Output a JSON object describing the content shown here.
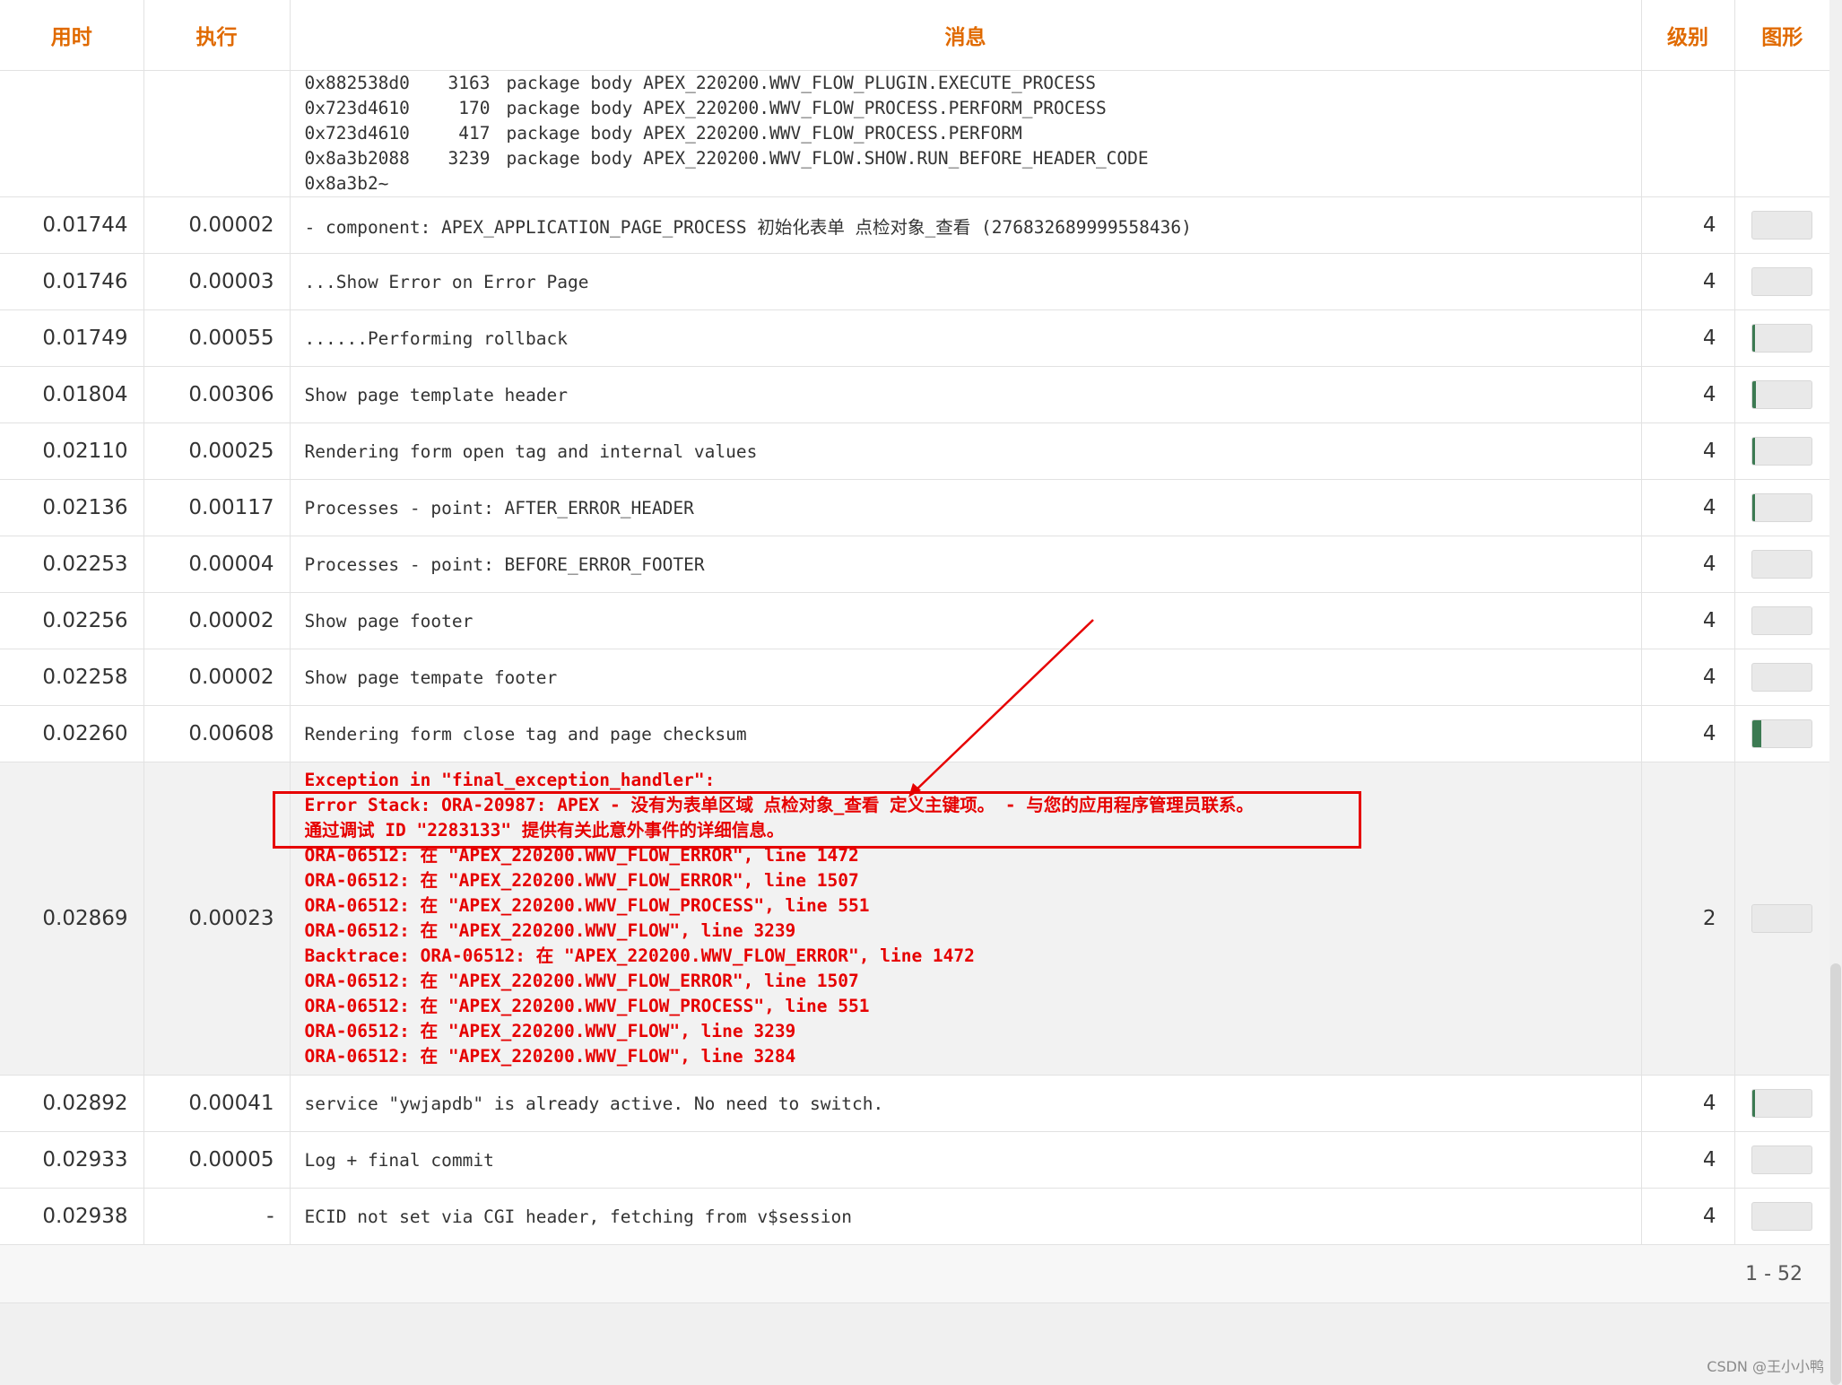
{
  "columns": {
    "elapsed": "用时",
    "exec": "执行",
    "message": "消息",
    "level": "级别",
    "graph": "图形"
  },
  "stack_lines": [
    {
      "addr": "0x882538d0",
      "line": "3163",
      "text": "package body APEX_220200.WWV_FLOW_PLUGIN.EXECUTE_PROCESS"
    },
    {
      "addr": "0x723d4610",
      "line": "170",
      "text": "package body APEX_220200.WWV_FLOW_PROCESS.PERFORM_PROCESS"
    },
    {
      "addr": "0x723d4610",
      "line": "417",
      "text": "package body APEX_220200.WWV_FLOW_PROCESS.PERFORM"
    },
    {
      "addr": "0x8a3b2088",
      "line": "3239",
      "text": "package body APEX_220200.WWV_FLOW.SHOW.RUN_BEFORE_HEADER_CODE"
    },
    {
      "addr": "0x8a3b2~",
      "line": "",
      "text": ""
    }
  ],
  "rows_a": [
    {
      "elapsed": "0.01744",
      "exec": "0.00002",
      "message": "- component: APEX_APPLICATION_PAGE_PROCESS 初始化表单 点检对象_查看 (276832689999558436)",
      "level": "4",
      "fill": 0.0
    },
    {
      "elapsed": "0.01746",
      "exec": "0.00003",
      "message": "...Show Error on Error Page",
      "level": "4",
      "fill": 0.0
    },
    {
      "elapsed": "0.01749",
      "exec": "0.00055",
      "message": "......Performing rollback",
      "level": "4",
      "fill": 0.02
    },
    {
      "elapsed": "0.01804",
      "exec": "0.00306",
      "message": "Show page template header",
      "level": "4",
      "fill": 0.06
    },
    {
      "elapsed": "0.02110",
      "exec": "0.00025",
      "message": "Rendering form open tag and internal values",
      "level": "4",
      "fill": 0.01
    },
    {
      "elapsed": "0.02136",
      "exec": "0.00117",
      "message": "Processes - point: AFTER_ERROR_HEADER",
      "level": "4",
      "fill": 0.03
    },
    {
      "elapsed": "0.02253",
      "exec": "0.00004",
      "message": "Processes - point: BEFORE_ERROR_FOOTER",
      "level": "4",
      "fill": 0.0
    },
    {
      "elapsed": "0.02256",
      "exec": "0.00002",
      "message": "Show page footer",
      "level": "4",
      "fill": 0.0
    },
    {
      "elapsed": "0.02258",
      "exec": "0.00002",
      "message": "Show page tempate footer",
      "level": "4",
      "fill": 0.0
    },
    {
      "elapsed": "0.02260",
      "exec": "0.00608",
      "message": "Rendering form close tag and page checksum",
      "level": "4",
      "fill": 0.15
    }
  ],
  "error_row": {
    "elapsed": "0.02869",
    "exec": "0.00023",
    "level": "2",
    "fill": 0.0,
    "lines": [
      "Exception in \"final_exception_handler\":",
      "Error Stack: ORA-20987: APEX - 没有为表单区域 点检对象_查看 定义主键项。 - 与您的应用程序管理员联系。",
      "通过调试 ID \"2283133\" 提供有关此意外事件的详细信息。",
      "ORA-06512: 在 \"APEX_220200.WWV_FLOW_ERROR\", line 1472",
      "ORA-06512: 在 \"APEX_220200.WWV_FLOW_ERROR\", line 1507",
      "ORA-06512: 在 \"APEX_220200.WWV_FLOW_PROCESS\", line 551",
      "ORA-06512: 在 \"APEX_220200.WWV_FLOW\", line 3239",
      "Backtrace: ORA-06512: 在 \"APEX_220200.WWV_FLOW_ERROR\", line 1472",
      "ORA-06512: 在 \"APEX_220200.WWV_FLOW_ERROR\", line 1507",
      "ORA-06512: 在 \"APEX_220200.WWV_FLOW_PROCESS\", line 551",
      "ORA-06512: 在 \"APEX_220200.WWV_FLOW\", line 3239",
      "ORA-06512: 在 \"APEX_220200.WWV_FLOW\", line 3284"
    ]
  },
  "rows_b": [
    {
      "elapsed": "0.02892",
      "exec": "0.00041",
      "message": "service \"ywjapdb\" is already active. No need to switch.",
      "level": "4",
      "fill": 0.01
    },
    {
      "elapsed": "0.02933",
      "exec": "0.00005",
      "message": "Log + final commit",
      "level": "4",
      "fill": 0.0
    },
    {
      "elapsed": "0.02938",
      "exec": "-",
      "message": "ECID not set via CGI header, fetching from v$session",
      "level": "4",
      "fill": 0.0
    }
  ],
  "pagination": "1 - 52",
  "watermark": "CSDN @王小小鸭",
  "colors": {
    "header": "#e06a00",
    "error": "#e60000",
    "bar_fill": "#3c7a52"
  }
}
